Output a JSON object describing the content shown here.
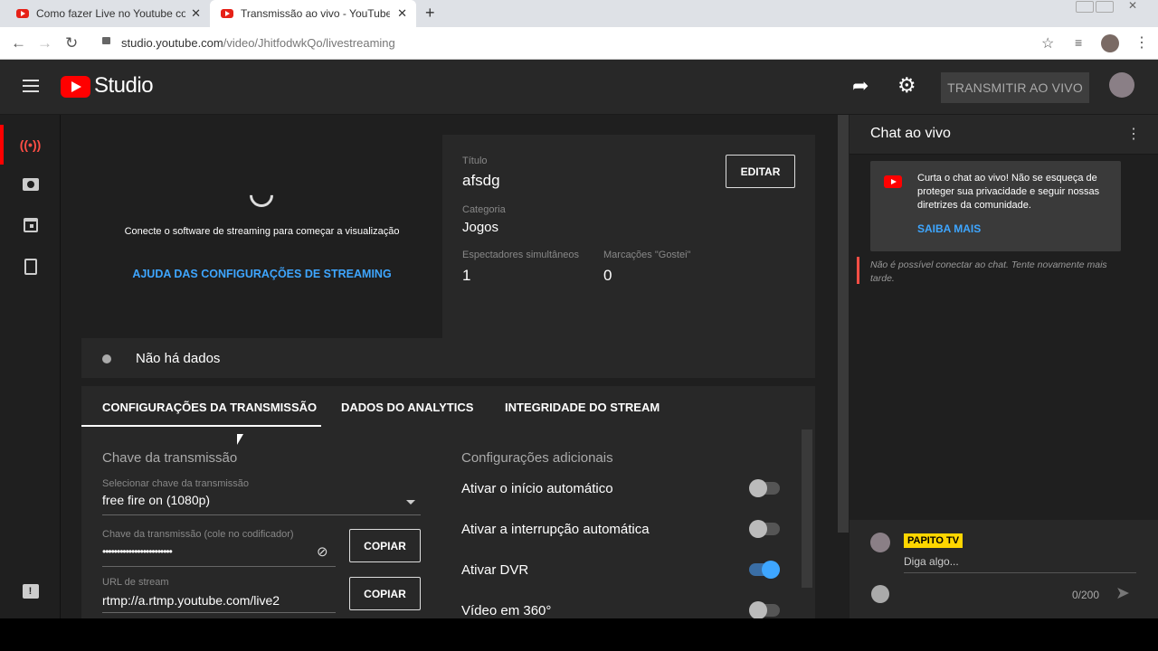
{
  "browser": {
    "tabs": [
      {
        "title": "Como fazer Live no Youtube com",
        "active": false
      },
      {
        "title": "Transmissão ao vivo - YouTube S",
        "active": true
      }
    ],
    "url_host": "studio.youtube.com",
    "url_path": "/video/JhitfodwkQo/livestreaming"
  },
  "header": {
    "logo_text": "Studio",
    "go_live_label": "TRANSMITIR AO VIVO"
  },
  "preview": {
    "message": "Conecte o software de streaming para começar a visualização",
    "help_link": "AJUDA DAS CONFIGURAÇÕES DE STREAMING"
  },
  "info": {
    "title_label": "Título",
    "title_value": "afsdg",
    "category_label": "Categoria",
    "category_value": "Jogos",
    "viewers_label": "Espectadores simultâneos",
    "viewers_value": "1",
    "likes_label": "Marcações \"Gostei\"",
    "likes_value": "0",
    "edit_label": "EDITAR"
  },
  "status": {
    "text": "Não há dados"
  },
  "tabs": [
    {
      "label": "CONFIGURAÇÕES DA TRANSMISSÃO",
      "active": true
    },
    {
      "label": "DADOS DO ANALYTICS",
      "active": false
    },
    {
      "label": "INTEGRIDADE DO STREAM",
      "active": false
    }
  ],
  "stream_key": {
    "section_title": "Chave da transmissão",
    "select_label": "Selecionar chave da transmissão",
    "select_value": "free fire on (1080p)",
    "key_label": "Chave da transmissão (cole no codificador)",
    "key_value": "••••••••••••••••••••••••",
    "copy_label": "COPIAR",
    "url_label": "URL de stream",
    "url_value": "rtmp://a.rtmp.youtube.com/live2",
    "copy_label_2": "COPIAR"
  },
  "additional": {
    "section_title": "Configurações adicionais",
    "options": [
      {
        "label": "Ativar o início automático",
        "on": false
      },
      {
        "label": "Ativar a interrupção automática",
        "on": false
      },
      {
        "label": "Ativar DVR",
        "on": true
      },
      {
        "label": "Vídeo em 360°",
        "on": false
      }
    ]
  },
  "chat": {
    "title": "Chat ao vivo",
    "notice": "Curta o chat ao vivo! Não se esqueça de proteger sua privacidade e seguir nossas diretrizes da comunidade.",
    "learn_more": "SAIBA MAIS",
    "error": "Não é possível conectar ao chat. Tente novamente mais tarde.",
    "username": "PAPITO TV",
    "input_placeholder": "Diga algo...",
    "counter": "0/200"
  },
  "colors": {
    "accent_red": "#ff0000",
    "link_blue": "#3ea6ff",
    "badge_yellow": "#ffd600"
  }
}
